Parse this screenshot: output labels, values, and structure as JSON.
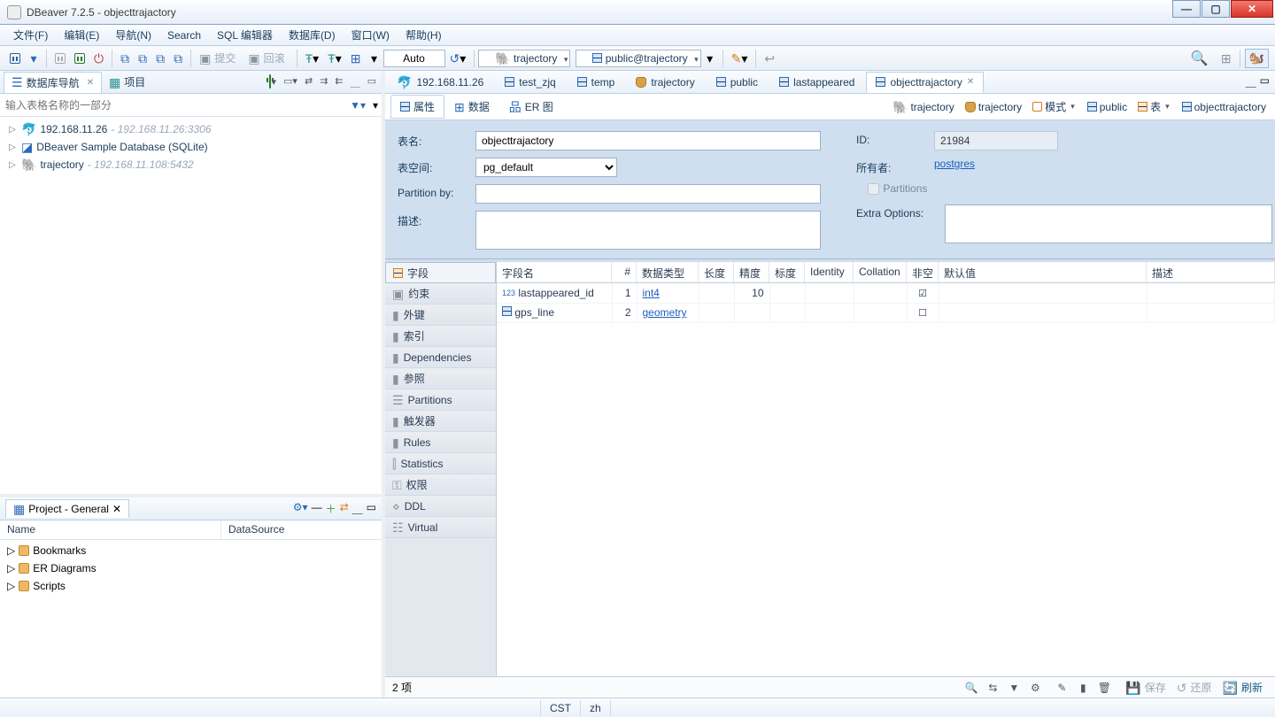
{
  "window": {
    "title": "DBeaver 7.2.5 - objecttrajactory"
  },
  "menu": [
    "文件(F)",
    "编辑(E)",
    "导航(N)",
    "Search",
    "SQL 编辑器",
    "数据库(D)",
    "窗口(W)",
    "帮助(H)"
  ],
  "toolbar": {
    "commit": "提交",
    "rollback": "回滚",
    "auto": "Auto",
    "combo1": "trajectory",
    "combo2": "public@trajectory"
  },
  "nav": {
    "tabs": {
      "navigator": "数据库导航",
      "project": "项目"
    },
    "filter_placeholder": "输入表格名称的一部分",
    "nodes": [
      {
        "label": "192.168.11.26",
        "hint": "- 192.168.11.26:3306",
        "icon": "mysql"
      },
      {
        "label": "DBeaver Sample Database (SQLite)",
        "hint": "",
        "icon": "sqlite"
      },
      {
        "label": "trajectory",
        "hint": "- 192.168.11.108:5432",
        "icon": "pg"
      }
    ]
  },
  "project": {
    "title": "Project - General",
    "cols": [
      "Name",
      "DataSource"
    ],
    "items": [
      "Bookmarks",
      "ER Diagrams",
      "Scripts"
    ]
  },
  "editor": {
    "tabs": [
      "192.168.11.26",
      "test_zjq",
      "temp",
      "trajectory",
      "public",
      "lastappeared",
      "objecttrajactory"
    ],
    "active": 6,
    "subtabs": {
      "props": "属性",
      "data": "数据",
      "er": "ER 图"
    },
    "breadcrumb": [
      "trajectory",
      "trajectory",
      "模式",
      "public",
      "表",
      "objecttrajactory"
    ]
  },
  "form": {
    "labels": {
      "table_name": "表名:",
      "tablespace": "表空间:",
      "partition_by": "Partition by:",
      "description": "描述:",
      "id": "ID:",
      "owner": "所有者:",
      "extra": "Extra Options:",
      "partitions": "Partitions"
    },
    "values": {
      "table_name": "objecttrajactory",
      "tablespace": "pg_default",
      "partition_by": "",
      "description": "",
      "id": "21984",
      "owner": "postgres",
      "partitions_checked": false
    }
  },
  "categories": [
    "字段",
    "约束",
    "外键",
    "索引",
    "Dependencies",
    "参照",
    "Partitions",
    "触发器",
    "Rules",
    "Statistics",
    "权限",
    "DDL",
    "Virtual"
  ],
  "grid": {
    "headers": [
      "字段名",
      "#",
      "数据类型",
      "长度",
      "精度",
      "标度",
      "Identity",
      "Collation",
      "非空",
      "默认值",
      "描述"
    ],
    "rows": [
      {
        "icon": "123",
        "name": "lastappeared_id",
        "num": 1,
        "type": "int4",
        "len": "",
        "prec": "10",
        "scale": "",
        "identity": "",
        "collation": "",
        "notnull": true,
        "default": "",
        "desc": ""
      },
      {
        "icon": "geom",
        "name": "gps_line",
        "num": 2,
        "type": "geometry",
        "len": "",
        "prec": "",
        "scale": "",
        "identity": "",
        "collation": "",
        "notnull": false,
        "default": "",
        "desc": ""
      }
    ]
  },
  "footer": {
    "count": "2 项",
    "save": "保存",
    "revert": "还原",
    "refresh": "刷新"
  },
  "status": [
    "CST",
    "zh"
  ]
}
